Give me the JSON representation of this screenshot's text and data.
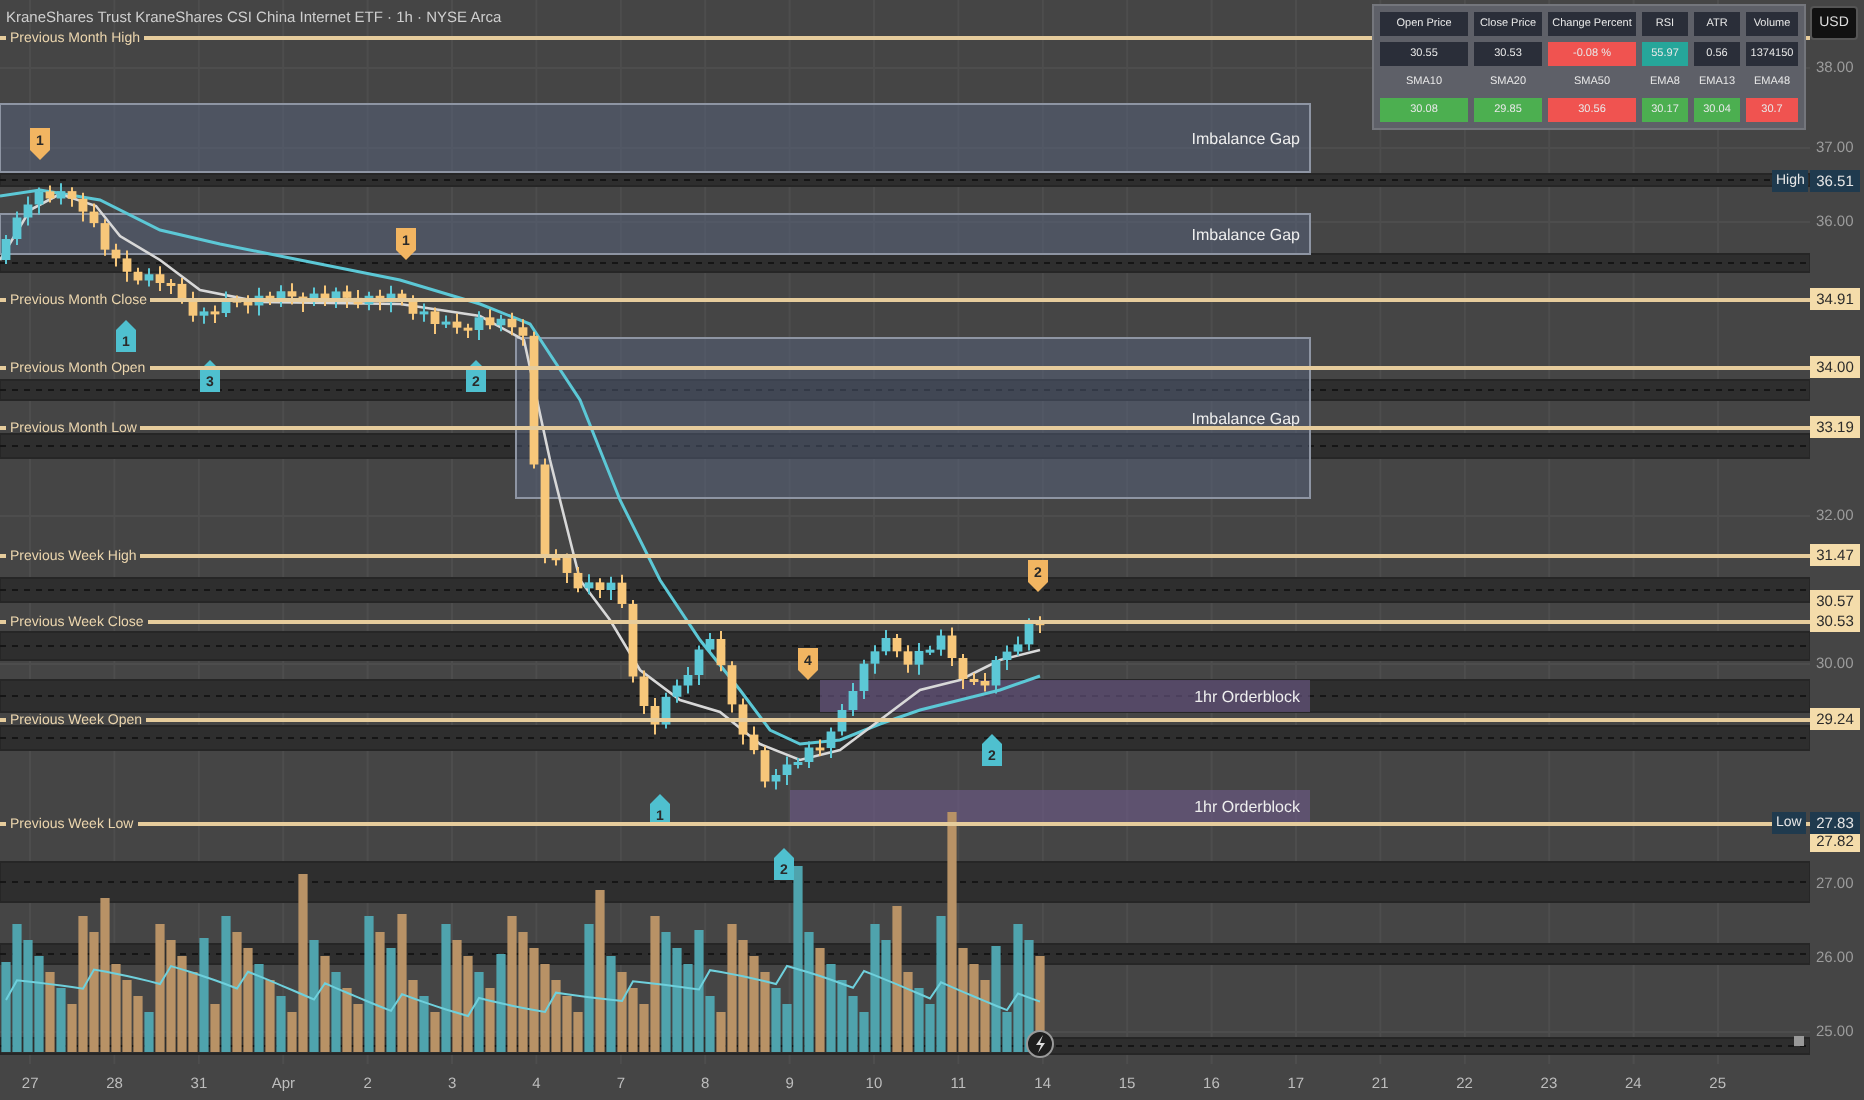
{
  "title": "KraneShares Trust KraneShares CSI China Internet ETF · 1h · NYSE Arca",
  "currency_button": "USD",
  "levels": [
    {
      "label": "Previous Month High"
    },
    {
      "label": "Previous Month Close",
      "price": "34.91"
    },
    {
      "label": "Previous Month Open",
      "price": "34.00"
    },
    {
      "label": "Previous Month Low",
      "price": "33.19"
    },
    {
      "label": "Previous Week High",
      "price": "31.47"
    },
    {
      "label": "Previous Week Close",
      "price": "30.53"
    },
    {
      "label": "Previous Week Open",
      "price": "29.24"
    },
    {
      "label": "Previous Week Low",
      "price": "27.82"
    }
  ],
  "zones": [
    {
      "kind": "imbalance",
      "label": "Imbalance Gap"
    },
    {
      "kind": "imbalance",
      "label": "Imbalance Gap"
    },
    {
      "kind": "imbalance",
      "label": "Imbalance Gap"
    },
    {
      "kind": "orderblock",
      "label": "1hr Orderblock"
    },
    {
      "kind": "orderblock",
      "label": "1hr Orderblock"
    }
  ],
  "signals": [
    {
      "kind": "above",
      "label": "1"
    },
    {
      "kind": "below",
      "label": "1"
    },
    {
      "kind": "below",
      "label": "3"
    },
    {
      "kind": "above",
      "label": "1"
    },
    {
      "kind": "below",
      "label": "2"
    },
    {
      "kind": "below",
      "label": "1"
    },
    {
      "kind": "above",
      "label": "4"
    },
    {
      "kind": "below",
      "label": "2"
    },
    {
      "kind": "below",
      "label": "2"
    },
    {
      "kind": "above",
      "label": "2"
    }
  ],
  "stats_table": {
    "rows": [
      {
        "kind": "header",
        "cells": [
          {
            "text": "Open Price"
          },
          {
            "text": "Close Price"
          },
          {
            "text": "Change Percent"
          },
          {
            "text": "RSI"
          },
          {
            "text": "ATR"
          },
          {
            "text": "Volume"
          }
        ]
      },
      {
        "kind": "value",
        "cells": [
          {
            "text": "30.55",
            "color": "#2a2e39"
          },
          {
            "text": "30.53",
            "color": "#2a2e39"
          },
          {
            "text": "-0.08 %",
            "color": "#f05350"
          },
          {
            "text": "55.97",
            "color": "#26a69a"
          },
          {
            "text": "0.56",
            "color": "#2a2e39"
          },
          {
            "text": "1374150",
            "color": "#2a2e39"
          }
        ]
      },
      {
        "kind": "label",
        "cells": [
          {
            "text": "SMA10"
          },
          {
            "text": "SMA20"
          },
          {
            "text": "SMA50"
          },
          {
            "text": "EMA8"
          },
          {
            "text": "EMA13"
          },
          {
            "text": "EMA48"
          }
        ]
      },
      {
        "kind": "value",
        "cells": [
          {
            "text": "30.08",
            "color": "#4caf50"
          },
          {
            "text": "29.85",
            "color": "#4caf50"
          },
          {
            "text": "30.56",
            "color": "#f05350"
          },
          {
            "text": "30.17",
            "color": "#4caf50"
          },
          {
            "text": "30.04",
            "color": "#4caf50"
          },
          {
            "text": "30.7",
            "color": "#f05350"
          }
        ]
      }
    ]
  },
  "price_axis": {
    "ticks": [
      "38.00",
      "37.00",
      "36.00",
      "32.00",
      "30.00",
      "27.00",
      "26.00",
      "25.00"
    ],
    "tags": [
      {
        "kind": "high",
        "label": "High",
        "value": "36.51"
      },
      {
        "kind": "current",
        "value": "30.57"
      },
      {
        "kind": "low",
        "label": "Low",
        "value": "27.83"
      }
    ]
  },
  "time_axis": [
    "27",
    "28",
    "31",
    "Apr",
    "2",
    "3",
    "4",
    "7",
    "8",
    "9",
    "10",
    "11",
    "14",
    "15",
    "16",
    "17",
    "21",
    "22",
    "23",
    "24",
    "25"
  ]
}
